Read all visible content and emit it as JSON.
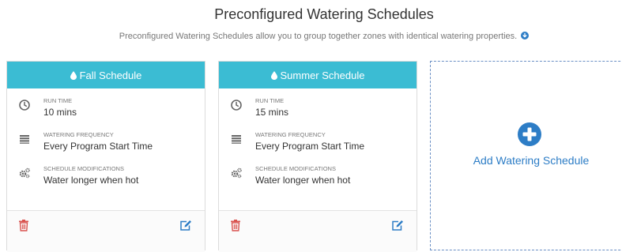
{
  "header": {
    "title": "Preconfigured Watering Schedules",
    "description": "Preconfigured Watering Schedules allow you to group together zones with identical watering properties."
  },
  "schedules": [
    {
      "name": "Fall Schedule",
      "run_time_label": "RUN TIME",
      "run_time_value": "10 mins",
      "frequency_label": "WATERING FREQUENCY",
      "frequency_value": "Every Program Start Time",
      "modifications_label": "SCHEDULE MODIFICATIONS",
      "modifications_value": "Water longer when hot"
    },
    {
      "name": "Summer Schedule",
      "run_time_label": "RUN TIME",
      "run_time_value": "15 mins",
      "frequency_label": "WATERING FREQUENCY",
      "frequency_value": "Every Program Start Time",
      "modifications_label": "SCHEDULE MODIFICATIONS",
      "modifications_value": "Water longer when hot"
    }
  ],
  "add_card": {
    "label": "Add Watering Schedule"
  },
  "icons": {
    "header_drop": "water-drop-icon",
    "run_time": "clock-icon",
    "frequency": "list-icon",
    "modifications": "gears-icon",
    "delete": "trash-icon",
    "edit": "edit-icon",
    "add": "plus-circle-icon",
    "info": "info-circle-icon"
  },
  "colors": {
    "header_bg": "#3bbcd3",
    "accent_blue": "#2d7dc6",
    "delete_red": "#d9534f",
    "dashed_border": "#6a8fc4"
  }
}
